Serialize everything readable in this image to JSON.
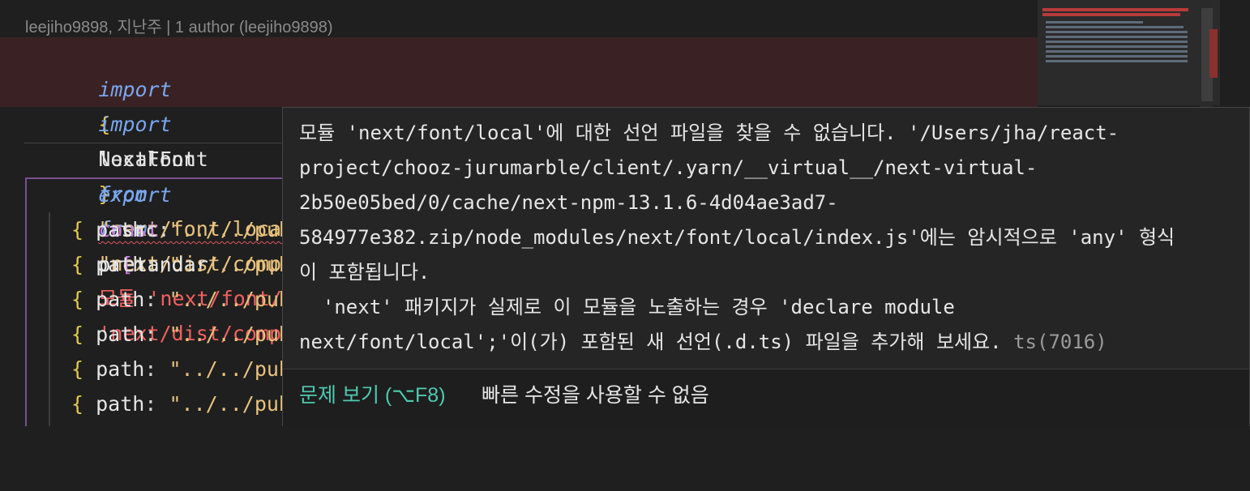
{
  "blame": "leejiho9898, 지난주 | 1 author (leejiho9898)",
  "code": {
    "line1": {
      "kw_import": "import",
      "open_brace": "{",
      "ident": "NextFont",
      "close_brace": "}",
      "kw_from": "from",
      "string": "\"next/dist/compiled/@next/font\"",
      "semi": ";",
      "inline_error": "'next/dist/compiled/@next/"
    },
    "line2": {
      "kw_import": "import",
      "ident": "localFont",
      "kw_from": "from",
      "string": "\"next/font/local\"",
      "semi": ";",
      "inline_error": "모듈 'next/font/local'에 대한 선언 파일을 찾"
    },
    "line4": {
      "kw_export": "export",
      "kw_const": "const",
      "ident": "pretandar"
    },
    "line5": {
      "prop": "src",
      "colon": ":",
      "bracket": "["
    },
    "path_rows": [
      {
        "brace": "{",
        "prop": "path",
        "colon": ":",
        "string": "\"../../pub"
      },
      {
        "brace": "{",
        "prop": "path",
        "colon": ":",
        "string": "\"../../pub"
      },
      {
        "brace": "{",
        "prop": "path",
        "colon": ":",
        "string": "\"../../pub"
      },
      {
        "brace": "{",
        "prop": "path",
        "colon": ":",
        "string": "\"../../pub"
      },
      {
        "brace": "{",
        "prop": "path",
        "colon": ":",
        "string": "\"../../pub"
      },
      {
        "brace": "{",
        "prop": "path",
        "colon": ":",
        "string": "\"../../pub"
      }
    ]
  },
  "hover": {
    "lines": [
      "모듈 'next/font/local'에 대한 선언 파일을 찾을 수 없습니다. '/Users/jha/react-",
      "project/chooz-jurumarble/client/.yarn/__virtual__/next-virtual-",
      "2b50e05bed/0/cache/next-npm-13.1.6-4d04ae3ad7-",
      "584977e382.zip/node_modules/next/font/local/index.js'에는 암시적으로 'any' 형식",
      "이 포함됩니다.",
      "  'next' 패키지가 실제로 이 모듈을 노출하는 경우 'declare module",
      "next/font/local';'이(가) 포함된 새 선언(.d.ts) 파일을 추가해 보세요. "
    ],
    "ts_code": "ts(7016)",
    "view_problem": "문제 보기 (⌥F8)",
    "no_quick_fix": "빠른 수정을 사용할 수 없음"
  },
  "colors": {
    "keyword_italic": "#7aa7f0",
    "keyword": "#c678dd",
    "string": "#e8c27e",
    "error": "#f0605f",
    "link": "#4ec9b0"
  }
}
